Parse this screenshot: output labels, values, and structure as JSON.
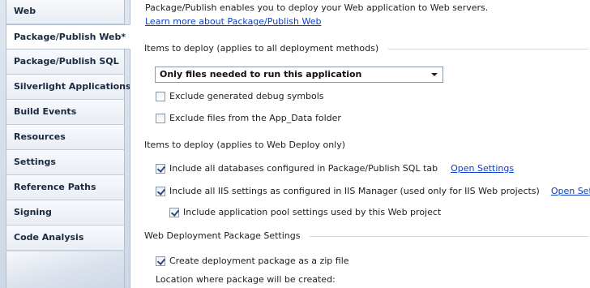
{
  "tabs": [
    {
      "label": "Web",
      "selected": false
    },
    {
      "label": "Package/Publish Web*",
      "selected": true
    },
    {
      "label": "Package/Publish SQL",
      "selected": false
    },
    {
      "label": "Silverlight Applications",
      "selected": false
    },
    {
      "label": "Build Events",
      "selected": false
    },
    {
      "label": "Resources",
      "selected": false
    },
    {
      "label": "Settings",
      "selected": false
    },
    {
      "label": "Reference Paths",
      "selected": false
    },
    {
      "label": "Signing",
      "selected": false
    },
    {
      "label": "Code Analysis",
      "selected": false
    }
  ],
  "intro": {
    "text": "Package/Publish enables you to deploy your Web application to Web servers.",
    "learn_more": "Learn more about Package/Publish Web"
  },
  "items_all": {
    "title": "Items to deploy (applies to all deployment methods)",
    "dropdown_value": "Only files needed to run this application",
    "exclude_debug": {
      "label": "Exclude generated debug symbols",
      "checked": false
    },
    "exclude_app_data": {
      "label": "Exclude files from the App_Data folder",
      "checked": false
    }
  },
  "items_webdeploy": {
    "title": "Items to deploy (applies to Web Deploy only)",
    "include_databases": {
      "label": "Include all databases configured in Package/Publish SQL tab",
      "checked": true,
      "link": "Open Settings"
    },
    "include_iis": {
      "label": "Include all IIS settings as configured in IIS Manager (used only for IIS Web projects)",
      "checked": true,
      "link": "Open Settings"
    },
    "include_app_pool": {
      "label": "Include application pool settings used by this Web project",
      "checked": true
    }
  },
  "package_settings": {
    "title": "Web Deployment Package Settings",
    "create_zip": {
      "label": "Create deployment package as a zip file",
      "checked": true
    },
    "location_label": "Location where package will be created:"
  },
  "colors": {
    "link": "#0b3ec6",
    "rail_background": "#cdd7e6",
    "tab_border": "#b3bfcf"
  }
}
